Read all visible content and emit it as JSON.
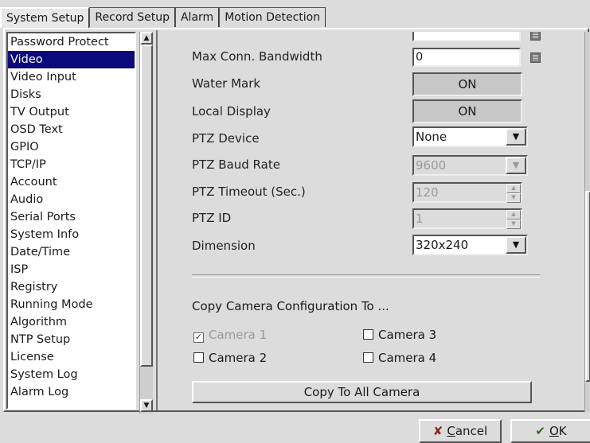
{
  "tabs": [
    "System Setup",
    "Record Setup",
    "Alarm",
    "Motion Detection"
  ],
  "sidebar": {
    "items": [
      "Password Protect",
      "Video",
      "Video Input",
      "Disks",
      "TV Output",
      "OSD Text",
      "GPIO",
      "TCP/IP",
      "Account",
      "Audio",
      "Serial Ports",
      "System Info",
      "Date/Time",
      "ISP",
      "Registry",
      "Running Mode",
      "Algorithm",
      "NTP Setup",
      "License",
      "System Log",
      "Alarm Log"
    ],
    "selected": "Video"
  },
  "settings": {
    "max_conn_bandwidth": {
      "label": "Max Conn. Bandwidth",
      "value": "0"
    },
    "water_mark": {
      "label": "Water Mark",
      "value": "ON"
    },
    "local_display": {
      "label": "Local Display",
      "value": "ON"
    },
    "ptz_device": {
      "label": "PTZ Device",
      "value": "None"
    },
    "ptz_baud_rate": {
      "label": "PTZ Baud Rate",
      "value": "9600"
    },
    "ptz_timeout": {
      "label": "PTZ Timeout (Sec.)",
      "value": "120"
    },
    "ptz_id": {
      "label": "PTZ ID",
      "value": "1"
    },
    "dimension": {
      "label": "Dimension",
      "value": "320x240"
    }
  },
  "copy_section": {
    "title": "Copy Camera Configuration To ...",
    "camera1": "Camera 1",
    "camera2": "Camera 2",
    "camera3": "Camera 3",
    "camera4": "Camera 4",
    "copy_all": "Copy To All Camera"
  },
  "buttons": {
    "cancel_prefix": "C",
    "cancel_rest": "ancel",
    "ok_prefix": "O",
    "ok_rest": "K"
  },
  "colors": {
    "selection": "#0a0a7c",
    "background": "#dcdcdc"
  }
}
